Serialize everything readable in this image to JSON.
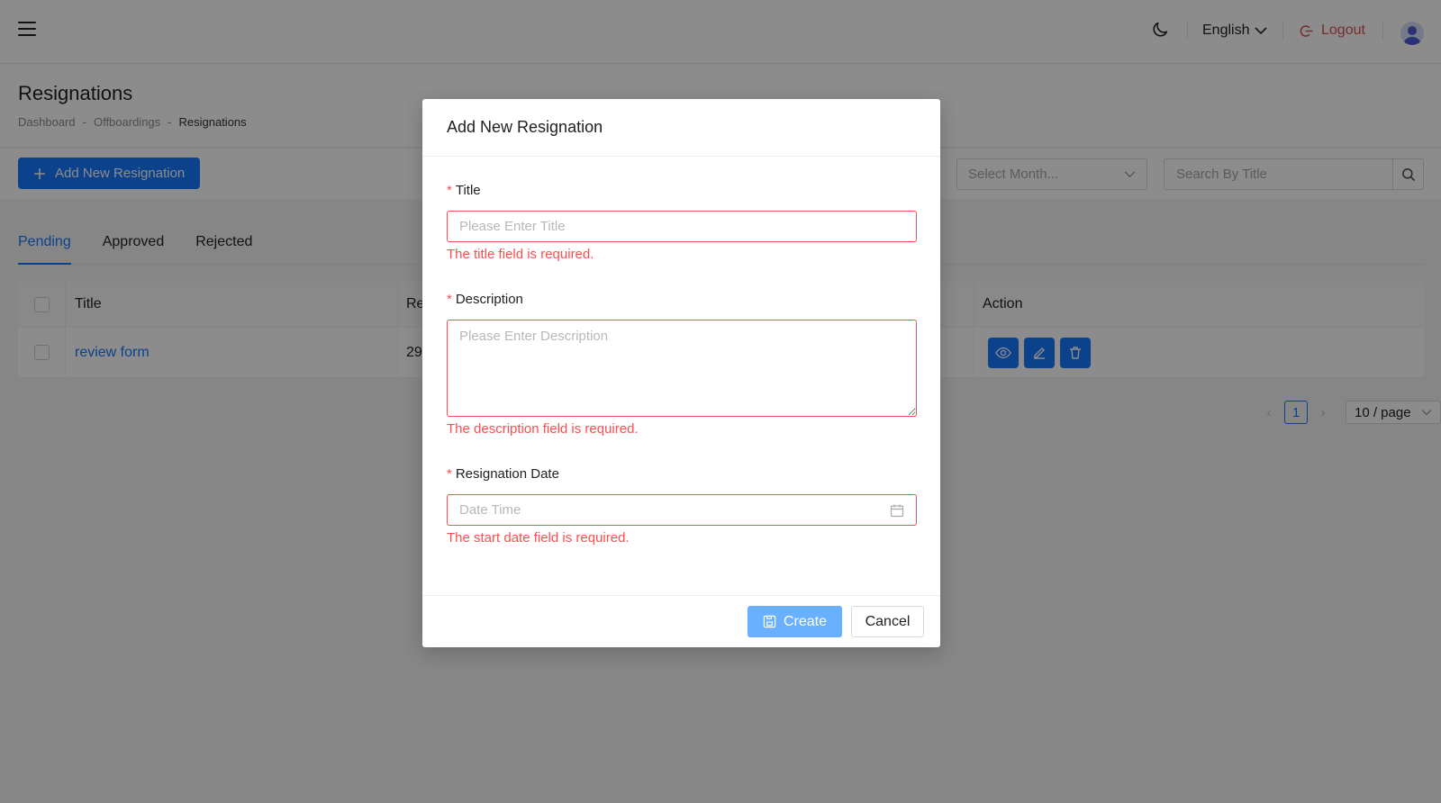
{
  "header": {
    "language": "English",
    "logout_label": "Logout"
  },
  "page": {
    "title": "Resignations",
    "breadcrumb": [
      "Dashboard",
      "Offboardings",
      "Resignations"
    ],
    "breadcrumb_separator": "-"
  },
  "toolbar": {
    "add_label": "Add New Resignation",
    "month_placeholder": "Select Month...",
    "search_placeholder": "Search By Title"
  },
  "tabs": [
    {
      "label": "Pending",
      "active": true
    },
    {
      "label": "Approved",
      "active": false
    },
    {
      "label": "Rejected",
      "active": false
    }
  ],
  "table": {
    "columns": [
      "Title",
      "Re",
      "Action"
    ],
    "rows": [
      {
        "title": "review form",
        "col2": "29"
      }
    ]
  },
  "pagination": {
    "current_page": "1",
    "page_size": "10 / page"
  },
  "modal": {
    "title": "Add New Resignation",
    "fields": {
      "title": {
        "label": "Title",
        "placeholder": "Please Enter Title",
        "error": "The title field is required."
      },
      "description": {
        "label": "Description",
        "placeholder": "Please Enter Description",
        "error": "The description field is required."
      },
      "date": {
        "label": "Resignation Date",
        "placeholder": "Date Time",
        "error": "The start date field is required."
      }
    },
    "required_mark": "*",
    "create_label": "Create",
    "cancel_label": "Cancel"
  },
  "colors": {
    "primary": "#1677ff",
    "error": "#ff4d4f",
    "overlay": "rgba(0,0,0,0.45)"
  }
}
